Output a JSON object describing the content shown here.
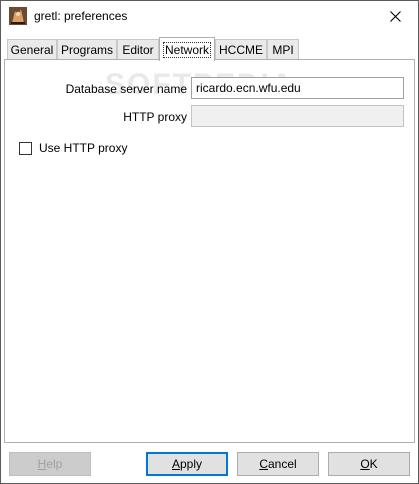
{
  "window": {
    "title": "gretl: preferences"
  },
  "tabs": [
    {
      "label": "General",
      "active": false
    },
    {
      "label": "Programs",
      "active": false
    },
    {
      "label": "Editor",
      "active": false
    },
    {
      "label": "Network",
      "active": true
    },
    {
      "label": "HCCME",
      "active": false
    },
    {
      "label": "MPI",
      "active": false
    }
  ],
  "network": {
    "db_server_label": "Database server name",
    "db_server_value": "ricardo.ecn.wfu.edu",
    "http_proxy_label": "HTTP proxy",
    "http_proxy_value": "",
    "use_proxy_label": "Use HTTP proxy",
    "use_proxy_checked": false
  },
  "watermark": "SOFTPEDIA",
  "buttons": {
    "help": {
      "prefix": "",
      "mnemonic": "H",
      "rest": "elp"
    },
    "apply": {
      "prefix": "",
      "mnemonic": "A",
      "rest": "pply"
    },
    "cancel": {
      "prefix": "",
      "mnemonic": "C",
      "rest": "ancel"
    },
    "ok": {
      "prefix": "",
      "mnemonic": "O",
      "rest": "K"
    }
  },
  "colors": {
    "accent": "#0078d7",
    "disabled_button": "#cccccc"
  }
}
